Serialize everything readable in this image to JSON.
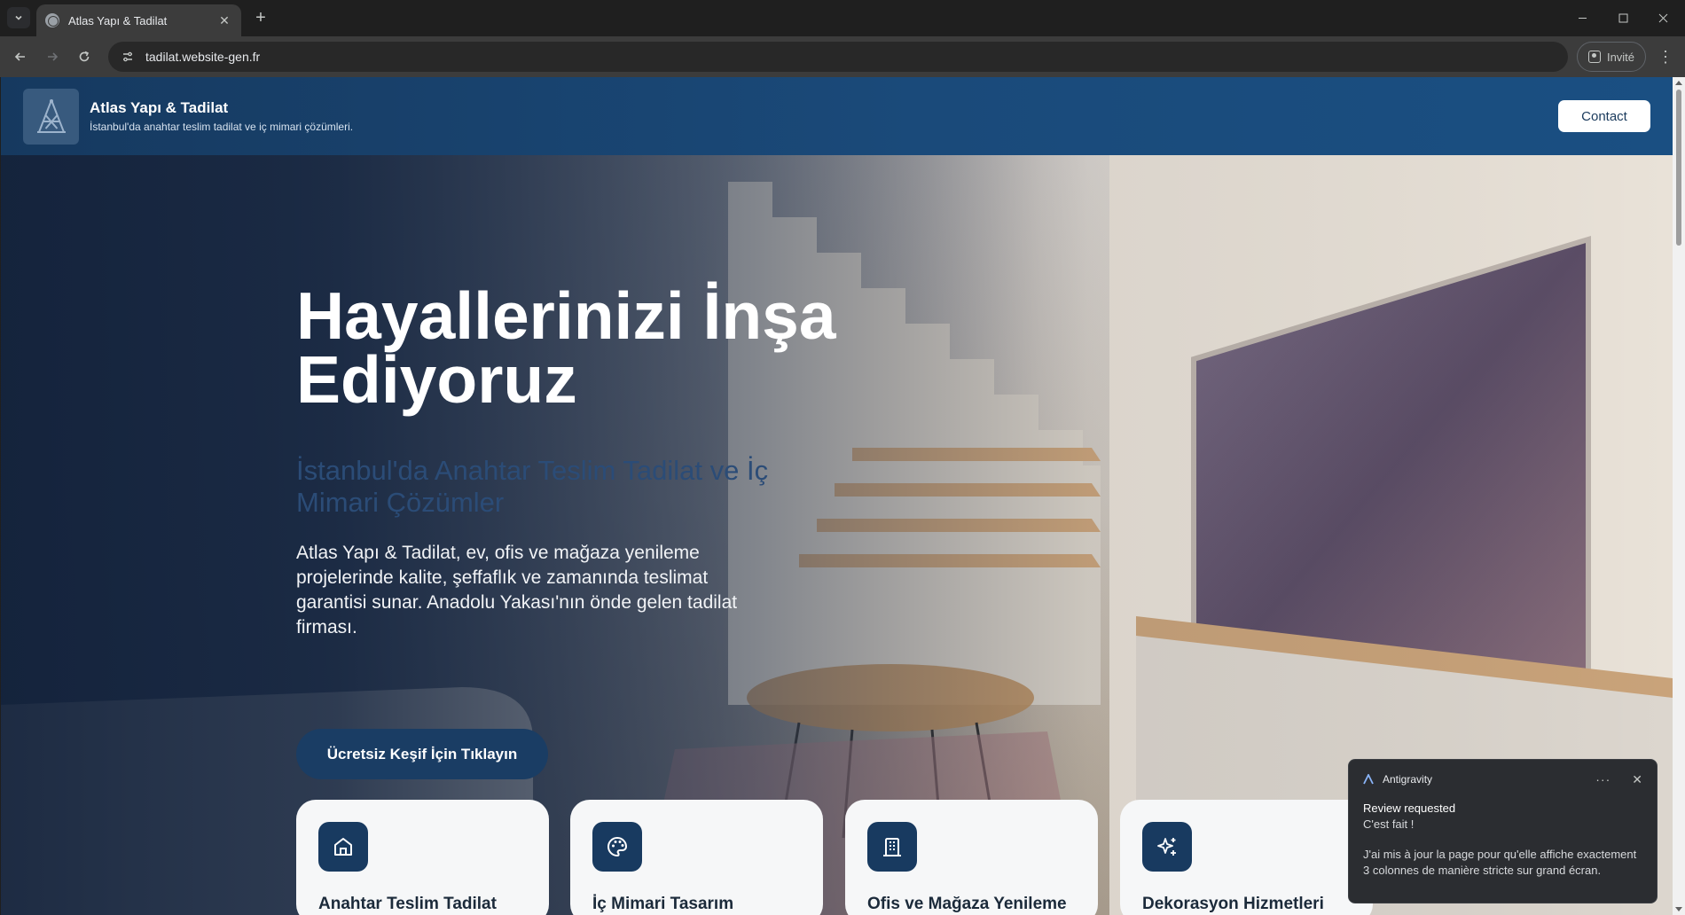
{
  "browser": {
    "tab_title": "Atlas Yapı & Tadilat",
    "url": "tadilat.website-gen.fr",
    "profile_label": "Invité"
  },
  "header": {
    "brand_name": "Atlas Yapı & Tadilat",
    "brand_tagline": "İstanbul'da anahtar teslim tadilat ve iç mimari çözümleri.",
    "contact_label": "Contact"
  },
  "hero": {
    "title": "Hayallerinizi İnşa Ediyoruz",
    "subtitle": "İstanbul'da Anahtar Teslim Tadilat ve İç Mimari Çözümler",
    "text": "Atlas Yapı & Tadilat, ev, ofis ve mağaza yenileme projelerinde kalite, şeffaflık ve zamanında teslimat garantisi sunar. Anadolu Yakası'nın önde gelen tadilat firması.",
    "cta_label": "Ücretsiz Keşif İçin Tıklayın"
  },
  "services": [
    {
      "title": "Anahtar Teslim Tadilat",
      "icon": "home-icon"
    },
    {
      "title": "İç Mimari Tasarım",
      "icon": "palette-icon"
    },
    {
      "title": "Ofis ve Mağaza Yenileme",
      "icon": "building-icon"
    },
    {
      "title": "Dekorasyon Hizmetleri",
      "icon": "sparkles-icon"
    }
  ],
  "notification": {
    "app": "Antigravity",
    "title": "Review requested",
    "line": "C'est fait !",
    "body": "J'ai mis à jour la page pour qu'elle affiche exactement 3 colonnes de manière stricte sur grand écran."
  },
  "colors": {
    "header_blue": "#1a4a7a",
    "cta_blue": "#1a3d64",
    "icon_blue": "#183a60",
    "card_bg": "#f6f7f8"
  }
}
